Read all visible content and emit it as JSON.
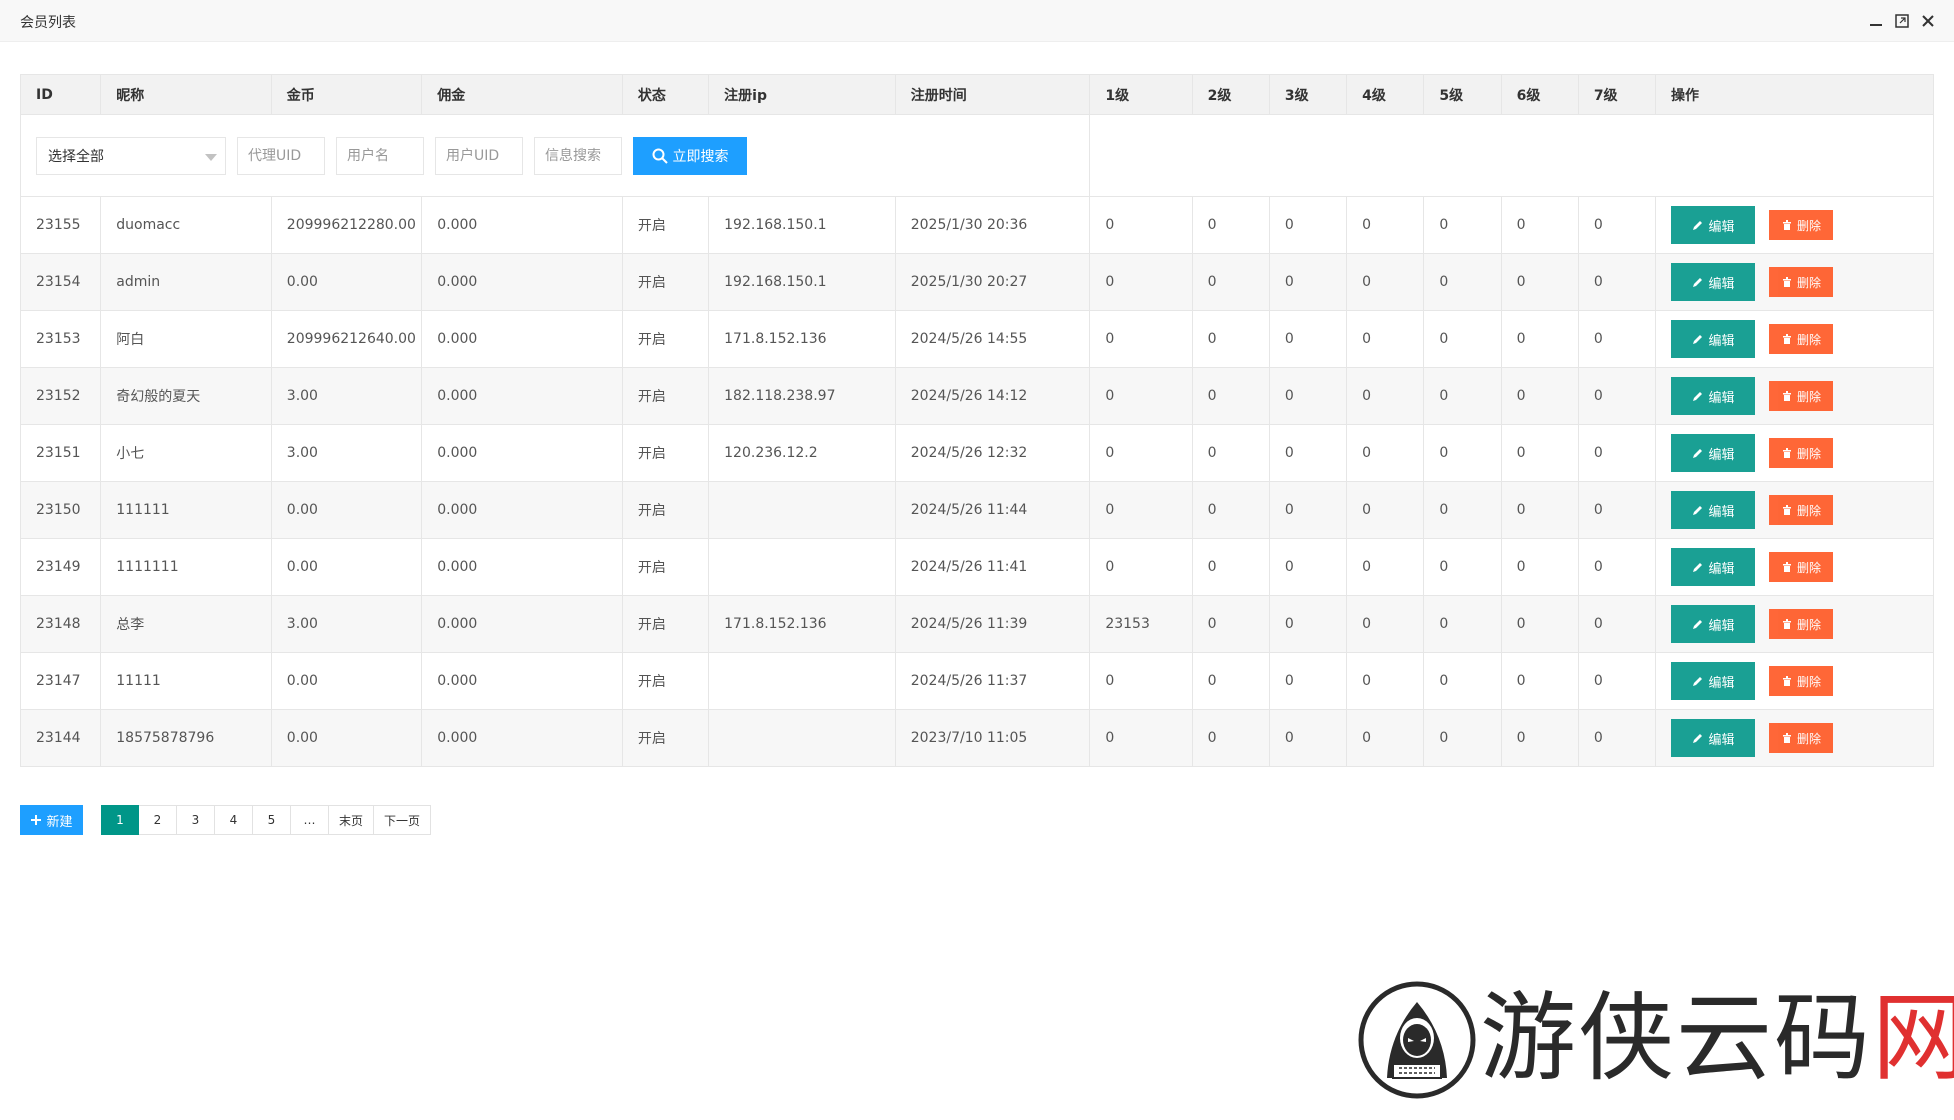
{
  "window": {
    "title": "会员列表"
  },
  "table": {
    "headers": [
      "ID",
      "昵称",
      "金币",
      "佣金",
      "状态",
      "注册ip",
      "注册时间",
      "1级",
      "2级",
      "3级",
      "4级",
      "5级",
      "6级",
      "7级",
      "操作"
    ],
    "filters": {
      "select_value": "选择全部",
      "agent_uid_placeholder": "代理UID",
      "username_placeholder": "用户名",
      "user_uid_placeholder": "用户UID",
      "info_search_placeholder": "信息搜索",
      "search_button": "立即搜索"
    },
    "rows": [
      [
        "23155",
        "duomacc",
        "209996212280.00",
        "0.000",
        "开启",
        "192.168.150.1",
        "2025/1/30 20:36",
        "0",
        "0",
        "0",
        "0",
        "0",
        "0",
        "0"
      ],
      [
        "23154",
        "admin",
        "0.00",
        "0.000",
        "开启",
        "192.168.150.1",
        "2025/1/30 20:27",
        "0",
        "0",
        "0",
        "0",
        "0",
        "0",
        "0"
      ],
      [
        "23153",
        "阿白",
        "209996212640.00",
        "0.000",
        "开启",
        "171.8.152.136",
        "2024/5/26 14:55",
        "0",
        "0",
        "0",
        "0",
        "0",
        "0",
        "0"
      ],
      [
        "23152",
        "奇幻般的夏天",
        "3.00",
        "0.000",
        "开启",
        "182.118.238.97",
        "2024/5/26 14:12",
        "0",
        "0",
        "0",
        "0",
        "0",
        "0",
        "0"
      ],
      [
        "23151",
        "小七",
        "3.00",
        "0.000",
        "开启",
        "120.236.12.2",
        "2024/5/26 12:32",
        "0",
        "0",
        "0",
        "0",
        "0",
        "0",
        "0"
      ],
      [
        "23150",
        "111111",
        "0.00",
        "0.000",
        "开启",
        "",
        "2024/5/26 11:44",
        "0",
        "0",
        "0",
        "0",
        "0",
        "0",
        "0"
      ],
      [
        "23149",
        "1111111",
        "0.00",
        "0.000",
        "开启",
        "",
        "2024/5/26 11:41",
        "0",
        "0",
        "0",
        "0",
        "0",
        "0",
        "0"
      ],
      [
        "23148",
        "总李",
        "3.00",
        "0.000",
        "开启",
        "171.8.152.136",
        "2024/5/26 11:39",
        "23153",
        "0",
        "0",
        "0",
        "0",
        "0",
        "0"
      ],
      [
        "23147",
        "11111",
        "0.00",
        "0.000",
        "开启",
        "",
        "2024/5/26 11:37",
        "0",
        "0",
        "0",
        "0",
        "0",
        "0",
        "0"
      ],
      [
        "23144",
        "18575878796",
        "0.00",
        "0.000",
        "开启",
        "",
        "2023/7/10 11:05",
        "0",
        "0",
        "0",
        "0",
        "0",
        "0",
        "0"
      ]
    ],
    "edit_label": "编辑",
    "delete_label": "删除"
  },
  "footer": {
    "new_button": "新建",
    "pages": [
      "1",
      "2",
      "3",
      "4",
      "5",
      "…",
      "末页",
      "下一页"
    ],
    "current_page": "1"
  },
  "watermark": {
    "text_main": "游侠云码",
    "text_accent": "网"
  },
  "colors": {
    "primary_blue": "#1e9fff",
    "edit_teal": "#1aa094",
    "delete_orange": "#ff5722",
    "active_page": "#009688",
    "status_green": "#2e9a2e"
  }
}
